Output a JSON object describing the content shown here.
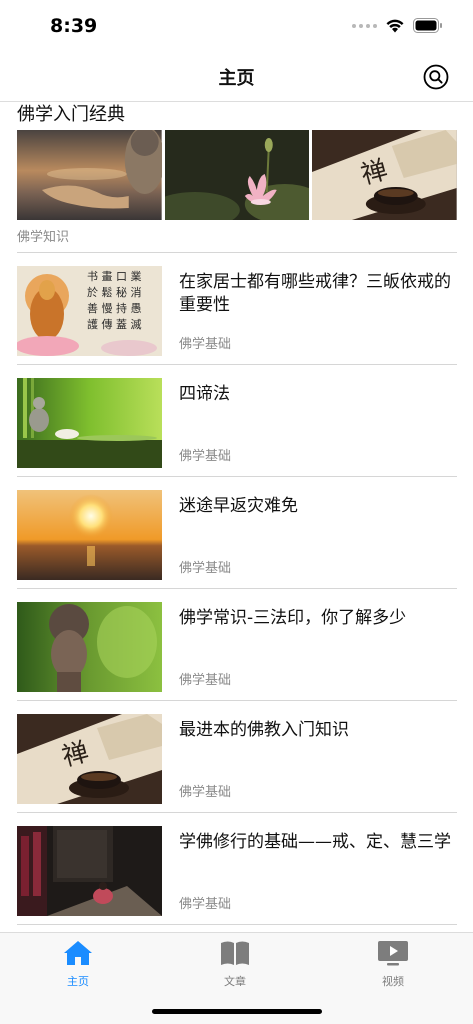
{
  "status_bar": {
    "time": "8:39",
    "wifi_icon": "wifi-icon",
    "battery_icon": "battery-icon"
  },
  "nav": {
    "title": "主页",
    "search_icon": "search-icon"
  },
  "featured": {
    "title": "佛学入门经典",
    "category": "佛学知识",
    "images": [
      "buddha-hand-image",
      "lotus-image",
      "tea-calligraphy-image"
    ]
  },
  "articles": [
    {
      "title": "在家居士都有哪些戒律？三皈依戒的重要性",
      "category": "佛学基础"
    },
    {
      "title": "四谛法",
      "category": "佛学基础"
    },
    {
      "title": "迷途早返灾难免",
      "category": "佛学基础"
    },
    {
      "title": "佛学常识-三法印，你了解多少",
      "category": "佛学基础"
    },
    {
      "title": "最进本的佛教入门知识",
      "category": "佛学基础"
    },
    {
      "title": "学佛修行的基础——戒、定、慧三学",
      "category": "佛学基础"
    }
  ],
  "tab_bar": {
    "tabs": [
      {
        "label": "主页",
        "icon": "home-icon",
        "active": true
      },
      {
        "label": "文章",
        "icon": "book-icon",
        "active": false
      },
      {
        "label": "视频",
        "icon": "video-icon",
        "active": false
      }
    ]
  },
  "colors": {
    "accent": "#1a8cff",
    "inactive": "#7d7d7d",
    "secondary_text": "#8a8a8a"
  }
}
